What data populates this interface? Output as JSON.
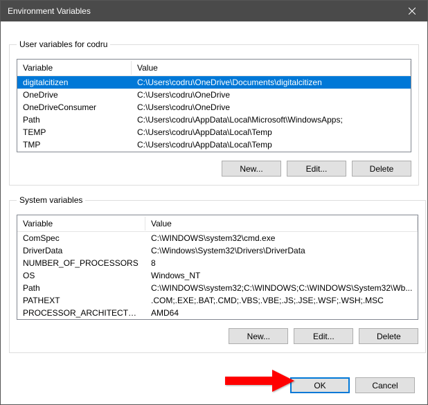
{
  "window": {
    "title": "Environment Variables"
  },
  "user_section": {
    "legend": "User variables for codru",
    "columns": {
      "var": "Variable",
      "val": "Value"
    },
    "rows": [
      {
        "name": "digitalcitizen",
        "value": "C:\\Users\\codru\\OneDrive\\Documents\\digitalcitizen",
        "selected": true
      },
      {
        "name": "OneDrive",
        "value": "C:\\Users\\codru\\OneDrive",
        "selected": false
      },
      {
        "name": "OneDriveConsumer",
        "value": "C:\\Users\\codru\\OneDrive",
        "selected": false
      },
      {
        "name": "Path",
        "value": "C:\\Users\\codru\\AppData\\Local\\Microsoft\\WindowsApps;",
        "selected": false
      },
      {
        "name": "TEMP",
        "value": "C:\\Users\\codru\\AppData\\Local\\Temp",
        "selected": false
      },
      {
        "name": "TMP",
        "value": "C:\\Users\\codru\\AppData\\Local\\Temp",
        "selected": false
      }
    ],
    "buttons": {
      "new": "New...",
      "edit": "Edit...",
      "delete": "Delete"
    }
  },
  "system_section": {
    "legend": "System variables",
    "columns": {
      "var": "Variable",
      "val": "Value"
    },
    "rows": [
      {
        "name": "ComSpec",
        "value": "C:\\WINDOWS\\system32\\cmd.exe"
      },
      {
        "name": "DriverData",
        "value": "C:\\Windows\\System32\\Drivers\\DriverData"
      },
      {
        "name": "NUMBER_OF_PROCESSORS",
        "value": "8"
      },
      {
        "name": "OS",
        "value": "Windows_NT"
      },
      {
        "name": "Path",
        "value": "C:\\WINDOWS\\system32;C:\\WINDOWS;C:\\WINDOWS\\System32\\Wb..."
      },
      {
        "name": "PATHEXT",
        "value": ".COM;.EXE;.BAT;.CMD;.VBS;.VBE;.JS;.JSE;.WSF;.WSH;.MSC"
      },
      {
        "name": "PROCESSOR_ARCHITECTURE",
        "value": "AMD64"
      }
    ],
    "buttons": {
      "new": "New...",
      "edit": "Edit...",
      "delete": "Delete"
    }
  },
  "dialog_buttons": {
    "ok": "OK",
    "cancel": "Cancel"
  }
}
